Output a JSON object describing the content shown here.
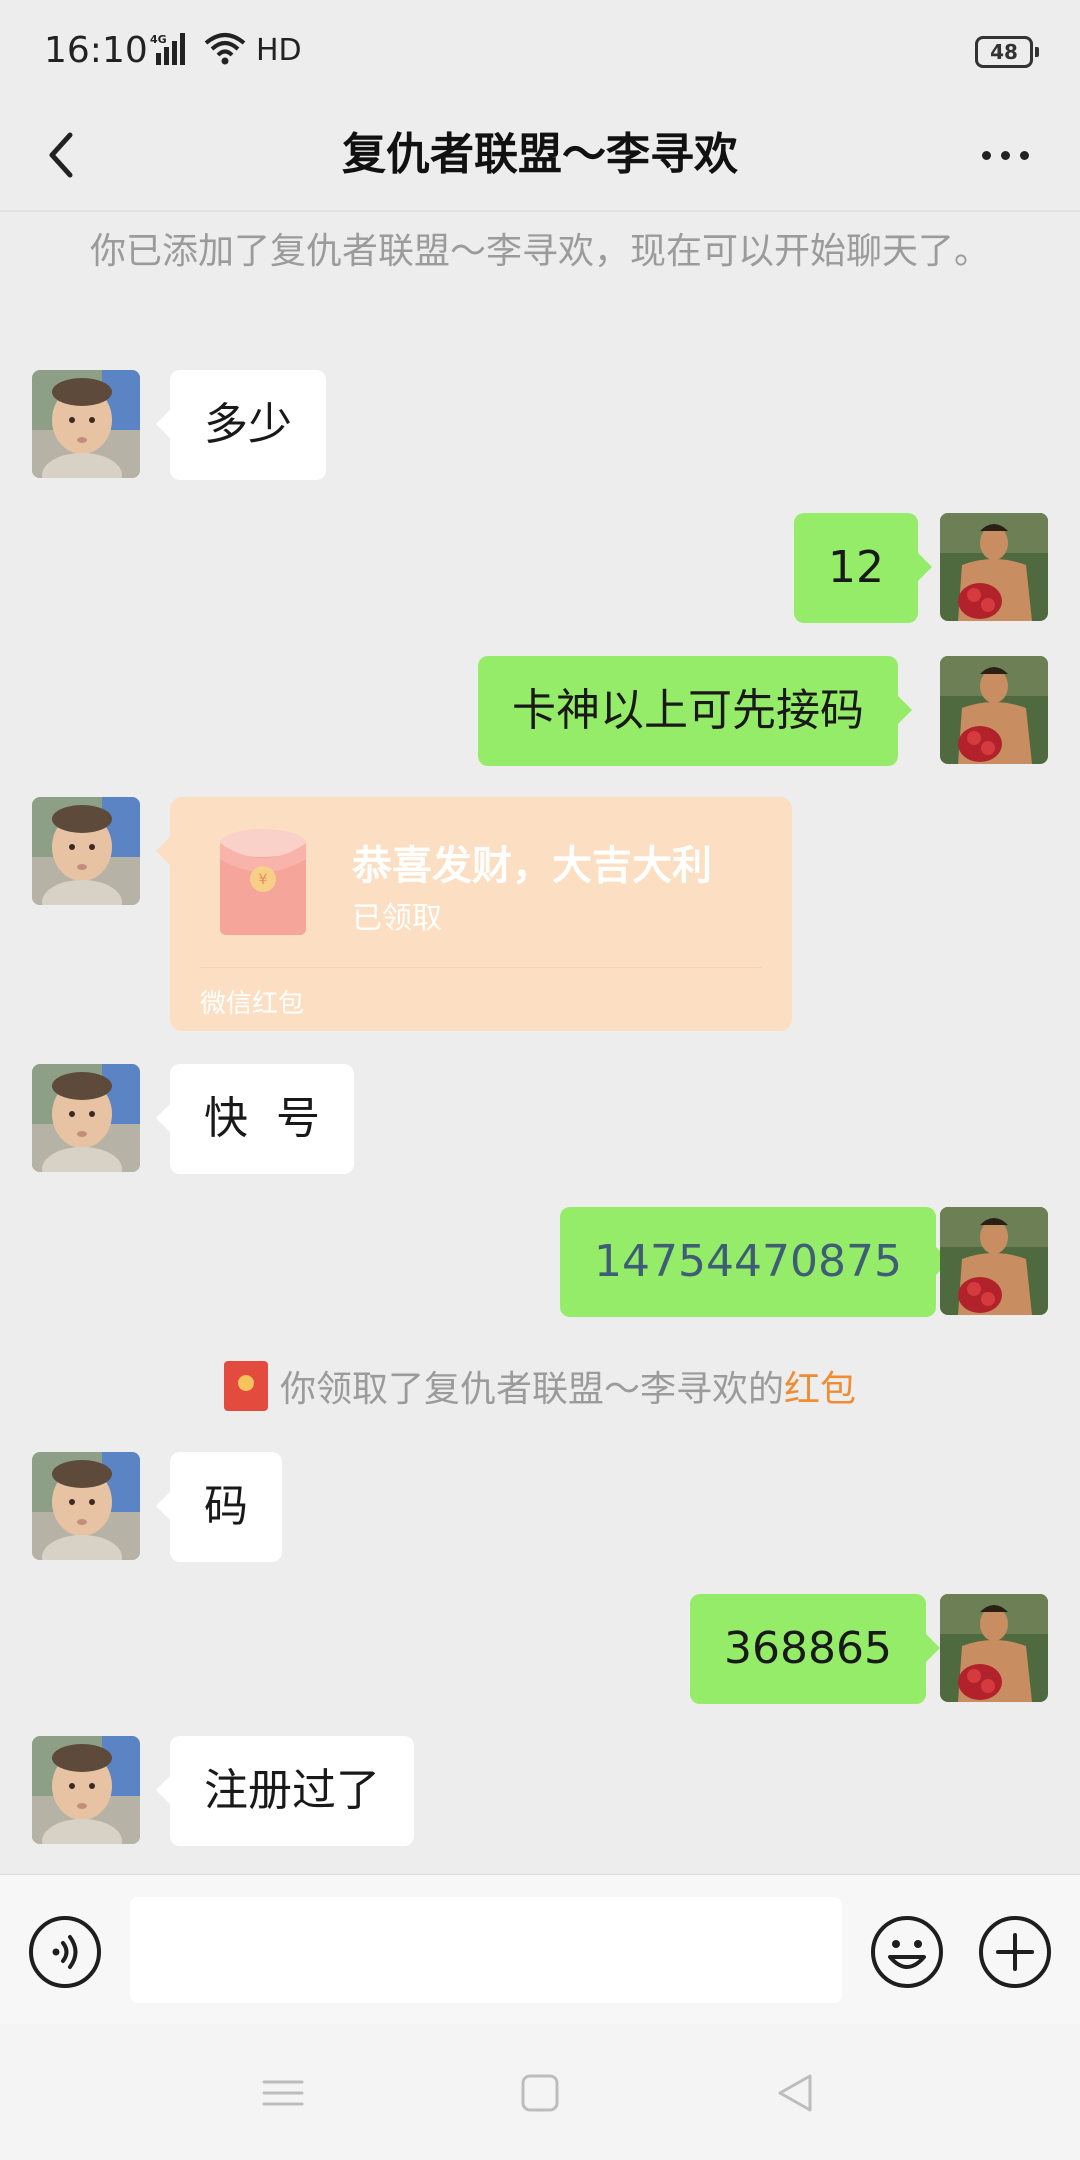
{
  "status_bar": {
    "time": "16:10",
    "network": "4G",
    "hd_label": "HD",
    "battery": "48"
  },
  "header": {
    "title": "复仇者联盟～李寻欢"
  },
  "system_notice": "你已添加了复仇者联盟～李寻欢，现在可以开始聊天了。",
  "messages": [
    {
      "side": "left",
      "text": "多少"
    },
    {
      "side": "right",
      "text": "12"
    },
    {
      "side": "right",
      "text": "卡神以上可先接码"
    },
    {
      "side": "left",
      "type": "red_packet",
      "title": "恭喜发财，大吉大利",
      "status": "已领取",
      "footer": "微信红包"
    },
    {
      "side": "left",
      "text": "快  号"
    },
    {
      "side": "right",
      "text": "14754470875"
    },
    {
      "side": "left",
      "text": "码"
    },
    {
      "side": "right",
      "text": "368865"
    },
    {
      "side": "left",
      "text": "注册过了"
    }
  ],
  "red_packet_notice": {
    "prefix": "你领取了复仇者联盟～李寻欢的",
    "link": "红包"
  },
  "input_bar": {
    "value": "",
    "placeholder": ""
  },
  "colors": {
    "background": "#ededed",
    "bubble_self": "#95ec69",
    "bubble_other": "#ffffff",
    "red_packet": "#fcdfc2",
    "link_orange": "#f08c34"
  },
  "icons": [
    "back-arrow-icon",
    "more-icon",
    "voice-icon",
    "emoji-icon",
    "plus-icon",
    "red-packet-icon",
    "menu-nav-icon",
    "home-nav-icon",
    "back-nav-icon"
  ]
}
